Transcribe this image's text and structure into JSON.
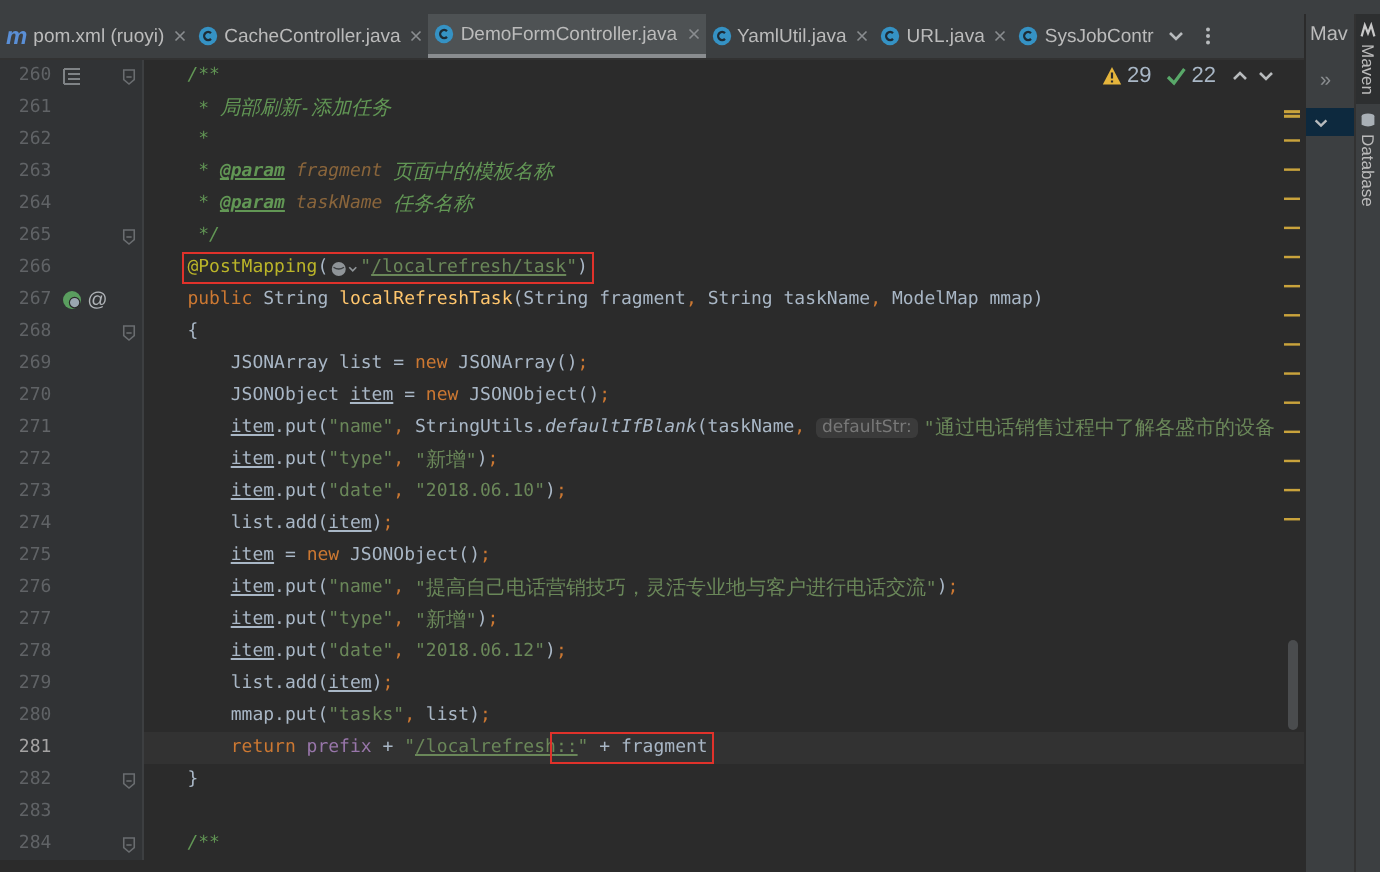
{
  "tabs": [
    {
      "kind": "maven",
      "badge": "m",
      "label": "pom.xml (ruoyi)",
      "selected": false,
      "closable": true
    },
    {
      "kind": "class",
      "label": "CacheController.java",
      "selected": false,
      "closable": true
    },
    {
      "kind": "class",
      "label": "DemoFormController.java",
      "selected": true,
      "closable": true
    },
    {
      "kind": "class",
      "label": "YamlUtil.java",
      "selected": false,
      "closable": true
    },
    {
      "kind": "class",
      "label": "URL.java",
      "selected": false,
      "closable": true
    },
    {
      "kind": "class",
      "label": "SysJobContr",
      "selected": false,
      "closable": false
    }
  ],
  "inspections": {
    "warnings": "29",
    "passed": "22"
  },
  "lines": [
    {
      "number": "260",
      "current": false,
      "fold": true,
      "gutter": [
        {
          "kind": "doc"
        }
      ],
      "tokens": [
        {
          "kind": "cmt",
          "text": "    /**"
        }
      ]
    },
    {
      "number": "261",
      "current": false,
      "tokens": [
        {
          "kind": "cmt",
          "text": "     * 局部刷新-添加任务"
        }
      ]
    },
    {
      "number": "262",
      "current": false,
      "tokens": [
        {
          "kind": "cmt",
          "text": "     *"
        }
      ]
    },
    {
      "number": "263",
      "current": false,
      "tokens": [
        {
          "kind": "cmt",
          "text": "     * "
        },
        {
          "kind": "doctag",
          "text": "@param"
        },
        {
          "kind": "docparam",
          "text": " fragment"
        },
        {
          "kind": "cmt",
          "text": " 页面中的模板名称"
        }
      ]
    },
    {
      "number": "264",
      "current": false,
      "tokens": [
        {
          "kind": "cmt",
          "text": "     * "
        },
        {
          "kind": "doctag",
          "text": "@param"
        },
        {
          "kind": "docparam",
          "text": " taskName"
        },
        {
          "kind": "cmt",
          "text": " 任务名称"
        }
      ]
    },
    {
      "number": "265",
      "current": false,
      "fold": true,
      "tokens": [
        {
          "kind": "cmt",
          "text": "     */"
        }
      ]
    },
    {
      "number": "266",
      "current": false,
      "tokens": [
        {
          "kind": "highlight",
          "tokens": [
            {
              "kind": "ann",
              "text": "    @PostMapping"
            },
            {
              "kind": "plain",
              "text": "("
            },
            {
              "kind": "globe"
            },
            {
              "kind": "str",
              "text": "\""
            },
            {
              "kind": "url",
              "text": "/localrefresh/task"
            },
            {
              "kind": "str",
              "text": "\""
            },
            {
              "kind": "plain",
              "text": ")"
            }
          ]
        }
      ]
    },
    {
      "number": "267",
      "current": false,
      "gutter": [
        {
          "kind": "endpoint"
        },
        {
          "kind": "text",
          "text": "@"
        }
      ],
      "tokens": [
        {
          "kind": "kw",
          "text": "    public"
        },
        {
          "kind": "plain",
          "text": " String "
        },
        {
          "kind": "decl",
          "text": "localRefreshTask"
        },
        {
          "kind": "plain",
          "text": "(String fragment"
        },
        {
          "kind": "kw",
          "text": ","
        },
        {
          "kind": "plain",
          "text": " String taskName"
        },
        {
          "kind": "kw",
          "text": ","
        },
        {
          "kind": "plain",
          "text": " ModelMap mmap)"
        }
      ]
    },
    {
      "number": "268",
      "current": false,
      "fold": true,
      "tokens": [
        {
          "kind": "plain",
          "text": "    {"
        }
      ]
    },
    {
      "number": "269",
      "current": false,
      "tokens": [
        {
          "kind": "plain",
          "text": "        JSONArray list = "
        },
        {
          "kind": "kw",
          "text": "new"
        },
        {
          "kind": "plain",
          "text": " JSONArray()"
        },
        {
          "kind": "kw",
          "text": ";"
        }
      ]
    },
    {
      "number": "270",
      "current": false,
      "tokens": [
        {
          "kind": "plain",
          "text": "        JSONObject "
        },
        {
          "kind": "var",
          "text": "item"
        },
        {
          "kind": "plain",
          "text": " = "
        },
        {
          "kind": "kw",
          "text": "new"
        },
        {
          "kind": "plain",
          "text": " JSONObject()"
        },
        {
          "kind": "kw",
          "text": ";"
        }
      ]
    },
    {
      "number": "271",
      "current": false,
      "tokens": [
        {
          "kind": "var",
          "text": "        item"
        },
        {
          "kind": "plain",
          "text": ".put("
        },
        {
          "kind": "str",
          "text": "\"name\""
        },
        {
          "kind": "kw",
          "text": ","
        },
        {
          "kind": "plain",
          "text": " StringUtils."
        },
        {
          "kind": "static",
          "text": "defaultIfBlank"
        },
        {
          "kind": "plain",
          "text": "(taskName"
        },
        {
          "kind": "kw",
          "text": ", "
        },
        {
          "kind": "hint",
          "text": "defaultStr:"
        },
        {
          "kind": "str",
          "text": "\"通过电话销售过程中了解各盛市的设备"
        }
      ]
    },
    {
      "number": "272",
      "current": false,
      "tokens": [
        {
          "kind": "var",
          "text": "        item"
        },
        {
          "kind": "plain",
          "text": ".put("
        },
        {
          "kind": "str",
          "text": "\"type\""
        },
        {
          "kind": "kw",
          "text": ", "
        },
        {
          "kind": "str",
          "text": "\"新增\""
        },
        {
          "kind": "plain",
          "text": ")"
        },
        {
          "kind": "kw",
          "text": ";"
        }
      ]
    },
    {
      "number": "273",
      "current": false,
      "tokens": [
        {
          "kind": "var",
          "text": "        item"
        },
        {
          "kind": "plain",
          "text": ".put("
        },
        {
          "kind": "str",
          "text": "\"date\""
        },
        {
          "kind": "kw",
          "text": ", "
        },
        {
          "kind": "str",
          "text": "\"2018.06.10\""
        },
        {
          "kind": "plain",
          "text": ")"
        },
        {
          "kind": "kw",
          "text": ";"
        }
      ]
    },
    {
      "number": "274",
      "current": false,
      "tokens": [
        {
          "kind": "plain",
          "text": "        list.add("
        },
        {
          "kind": "var",
          "text": "item"
        },
        {
          "kind": "plain",
          "text": ")"
        },
        {
          "kind": "kw",
          "text": ";"
        }
      ]
    },
    {
      "number": "275",
      "current": false,
      "tokens": [
        {
          "kind": "var",
          "text": "        item"
        },
        {
          "kind": "plain",
          "text": " = "
        },
        {
          "kind": "kw",
          "text": "new"
        },
        {
          "kind": "plain",
          "text": " JSONObject()"
        },
        {
          "kind": "kw",
          "text": ";"
        }
      ]
    },
    {
      "number": "276",
      "current": false,
      "tokens": [
        {
          "kind": "var",
          "text": "        item"
        },
        {
          "kind": "plain",
          "text": ".put("
        },
        {
          "kind": "str",
          "text": "\"name\""
        },
        {
          "kind": "kw",
          "text": ", "
        },
        {
          "kind": "str",
          "text": "\"提高自己电话营销技巧，灵活专业地与客户进行电话交流\""
        },
        {
          "kind": "plain",
          "text": ")"
        },
        {
          "kind": "kw",
          "text": ";"
        }
      ]
    },
    {
      "number": "277",
      "current": false,
      "tokens": [
        {
          "kind": "var",
          "text": "        item"
        },
        {
          "kind": "plain",
          "text": ".put("
        },
        {
          "kind": "str",
          "text": "\"type\""
        },
        {
          "kind": "kw",
          "text": ", "
        },
        {
          "kind": "str",
          "text": "\"新增\""
        },
        {
          "kind": "plain",
          "text": ")"
        },
        {
          "kind": "kw",
          "text": ";"
        }
      ]
    },
    {
      "number": "278",
      "current": false,
      "tokens": [
        {
          "kind": "var",
          "text": "        item"
        },
        {
          "kind": "plain",
          "text": ".put("
        },
        {
          "kind": "str",
          "text": "\"date\""
        },
        {
          "kind": "kw",
          "text": ", "
        },
        {
          "kind": "str",
          "text": "\"2018.06.12\""
        },
        {
          "kind": "plain",
          "text": ")"
        },
        {
          "kind": "kw",
          "text": ";"
        }
      ]
    },
    {
      "number": "279",
      "current": false,
      "tokens": [
        {
          "kind": "plain",
          "text": "        list.add("
        },
        {
          "kind": "var",
          "text": "item"
        },
        {
          "kind": "plain",
          "text": ")"
        },
        {
          "kind": "kw",
          "text": ";"
        }
      ]
    },
    {
      "number": "280",
      "current": false,
      "tokens": [
        {
          "kind": "plain",
          "text": "        mmap.put("
        },
        {
          "kind": "str",
          "text": "\"tasks\""
        },
        {
          "kind": "kw",
          "text": ","
        },
        {
          "kind": "plain",
          "text": " list)"
        },
        {
          "kind": "kw",
          "text": ";"
        }
      ]
    },
    {
      "number": "281",
      "current": true,
      "tokens": [
        {
          "kind": "kw",
          "text": "        return "
        },
        {
          "kind": "field",
          "text": "prefix"
        },
        {
          "kind": "plain",
          "text": " + "
        },
        {
          "kind": "str",
          "text": "\""
        },
        {
          "kind": "url",
          "text": "/localrefresh"
        },
        {
          "kind": "highlight",
          "tokens": [
            {
              "kind": "url",
              "text": "::"
            },
            {
              "kind": "str",
              "text": "\""
            },
            {
              "kind": "plain",
              "text": " + fragment"
            }
          ]
        }
      ]
    },
    {
      "number": "282",
      "current": false,
      "fold": true,
      "tokens": [
        {
          "kind": "plain",
          "text": "    }"
        }
      ]
    },
    {
      "number": "283",
      "current": false
    },
    {
      "number": "284",
      "current": false,
      "fold": true,
      "tokens": [
        {
          "kind": "cmt",
          "text": "    /**"
        }
      ]
    }
  ],
  "maven_panel": {
    "title": "Mav",
    "expand": "»"
  },
  "side_stripe": [
    {
      "kind": "maven",
      "label": "Maven",
      "selected": true
    },
    {
      "kind": "database",
      "label": "Database",
      "selected": false
    }
  ]
}
